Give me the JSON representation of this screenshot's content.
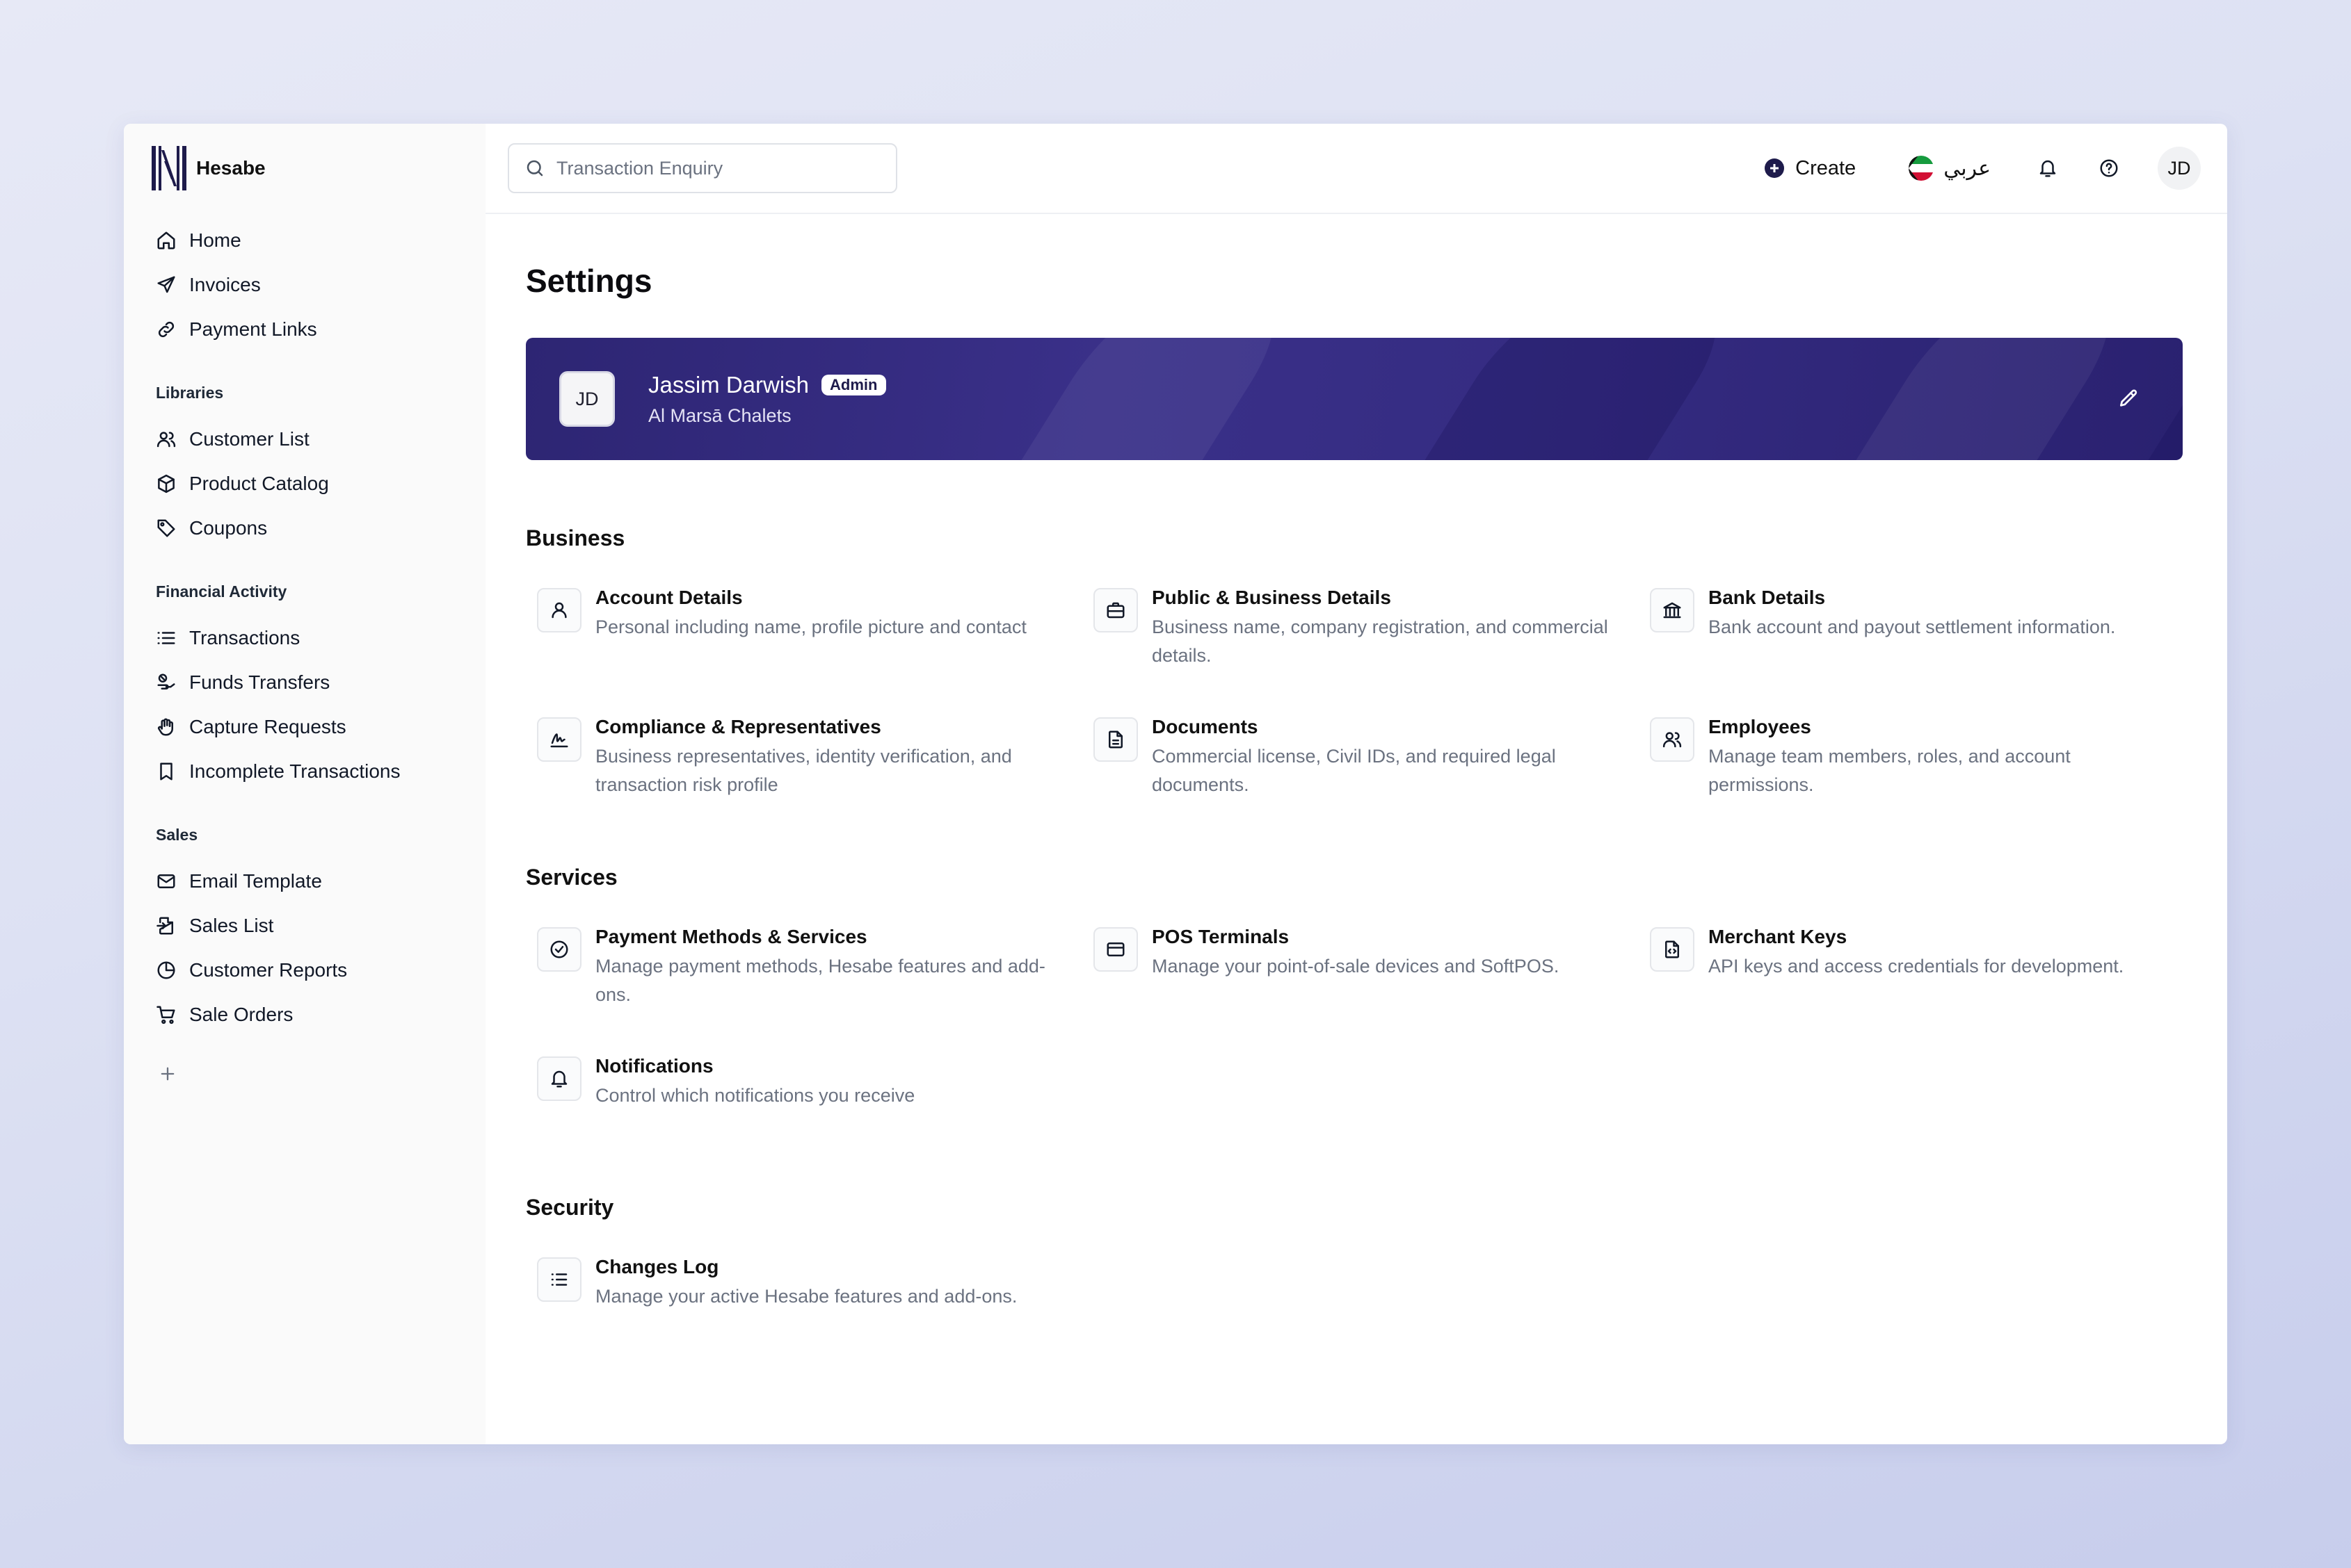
{
  "brand": {
    "name": "Hesabe"
  },
  "sidebar": {
    "main_items": [
      {
        "label": "Home"
      },
      {
        "label": "Invoices"
      },
      {
        "label": "Payment Links"
      }
    ],
    "groups": [
      {
        "heading": "Libraries",
        "items": [
          {
            "label": "Customer List"
          },
          {
            "label": "Product Catalog"
          },
          {
            "label": "Coupons"
          }
        ]
      },
      {
        "heading": "Financial Activity",
        "items": [
          {
            "label": "Transactions"
          },
          {
            "label": "Funds Transfers"
          },
          {
            "label": "Capture Requests"
          },
          {
            "label": "Incomplete Transactions"
          }
        ]
      },
      {
        "heading": "Sales",
        "items": [
          {
            "label": "Email Template"
          },
          {
            "label": "Sales List"
          },
          {
            "label": "Customer Reports"
          },
          {
            "label": "Sale Orders"
          }
        ]
      }
    ]
  },
  "topbar": {
    "search_placeholder": "Transaction Enquiry",
    "create_label": "Create",
    "language_label": "عربي",
    "user_initials": "JD"
  },
  "page": {
    "title": "Settings"
  },
  "profile": {
    "initials": "JD",
    "name": "Jassim Darwish",
    "role_badge": "Admin",
    "organization": "Al Marsā Chalets"
  },
  "sections": {
    "business": {
      "title": "Business",
      "items": [
        {
          "title": "Account Details",
          "desc": "Personal including name, profile picture and contact",
          "icon": "user-icon"
        },
        {
          "title": "Public & Business Details",
          "desc": "Business name, company registration, and commercial details.",
          "icon": "briefcase-icon"
        },
        {
          "title": "Bank Details",
          "desc": "Bank account and payout settlement information.",
          "icon": "bank-icon"
        },
        {
          "title": "Compliance & Representatives",
          "desc": "Business representatives, identity verification, and transaction risk profile",
          "icon": "signature-icon"
        },
        {
          "title": "Documents",
          "desc": "Commercial license, Civil IDs, and required legal documents.",
          "icon": "document-icon"
        },
        {
          "title": "Employees",
          "desc": "Manage team members, roles, and account permissions.",
          "icon": "users-icon"
        }
      ]
    },
    "services": {
      "title": "Services",
      "items": [
        {
          "title": "Payment Methods & Services",
          "desc": "Manage payment methods, Hesabe features and add-ons.",
          "icon": "check-circle-icon"
        },
        {
          "title": "POS Terminals",
          "desc": "Manage your point-of-sale devices and SoftPOS.",
          "icon": "card-icon"
        },
        {
          "title": "Merchant Keys",
          "desc": "API keys and access credentials for development.",
          "icon": "code-file-icon"
        },
        {
          "title": "Notifications",
          "desc": "Control which notifications you receive",
          "icon": "bell-icon"
        }
      ]
    },
    "security": {
      "title": "Security",
      "items": [
        {
          "title": "Changes Log",
          "desc": "Manage your active Hesabe features and add-ons.",
          "icon": "list-icon"
        }
      ]
    }
  },
  "colors": {
    "accent": "#2d2573",
    "text": "#111827",
    "muted": "#6b7280"
  }
}
